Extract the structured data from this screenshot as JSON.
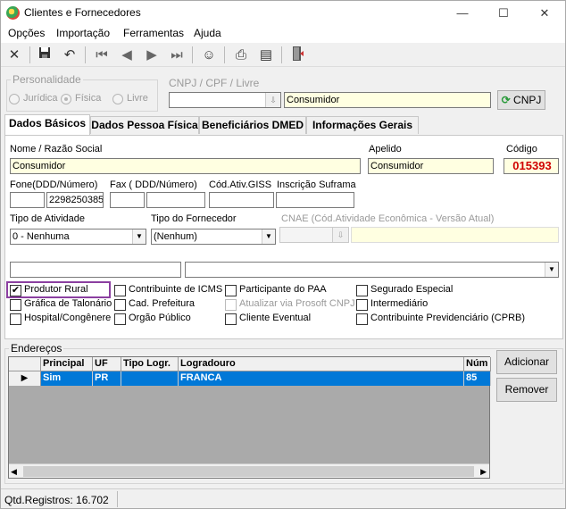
{
  "window": {
    "title": "Clientes e Fornecedores",
    "minimize": "—",
    "maximize": "☐",
    "close": "✕"
  },
  "menu": [
    "Opções",
    "Importação",
    "Ferramentas",
    "Ajuda"
  ],
  "toolbar_icons": [
    "close-icon",
    "save-icon",
    "undo-icon",
    "first-record-icon",
    "previous-record-icon",
    "next-record-icon",
    "last-record-icon",
    "people-icon",
    "print-icon",
    "report-icon",
    "exit-door-icon"
  ],
  "personalidade": {
    "legend": "Personalidade",
    "options": [
      "Jurídica",
      "Física",
      "Livre"
    ],
    "selected": "Física"
  },
  "cnpj": {
    "label": "CNPJ / CPF / Livre",
    "value": "",
    "description": "Consumidor",
    "button": "CNPJ"
  },
  "tabs": [
    "Dados Básicos",
    "Dados Pessoa Física",
    "Beneficiários DMED",
    "Informações Gerais"
  ],
  "form": {
    "nome_label": "Nome / Razão Social",
    "nome_value": "Consumidor",
    "apelido_label": "Apelido",
    "apelido_value": "Consumidor",
    "codigo_label": "Código",
    "codigo_value": "015393",
    "fone_label": "Fone(DDD/Número)",
    "fone_ddd": "",
    "fone_numero": "2298250385",
    "fax_label": "Fax ( DDD/Número)",
    "fax_ddd": "",
    "fax_numero": "",
    "cod_ativ_label": "Cód.Ativ.GISS",
    "cod_ativ_value": "",
    "suframa_label": "Inscrição Suframa",
    "suframa_value": "",
    "tipo_atividade_label": "Tipo de Atividade",
    "tipo_atividade_value": "0 - Nenhuma",
    "tipo_fornecedor_label": "Tipo do Fornecedor",
    "tipo_fornecedor_value": "(Nenhum)",
    "cnae_label": "CNAE (Cód.Atividade Econômica - Versão Atual)",
    "cnae_value": "",
    "extra_field_value": "",
    "extra_combo_value": ""
  },
  "checkboxes": [
    {
      "label": "Produtor Rural",
      "checked": true,
      "enabled": true
    },
    {
      "label": "Gráfica de Talonário",
      "checked": false,
      "enabled": true
    },
    {
      "label": "Hospital/Congênere",
      "checked": false,
      "enabled": true
    },
    {
      "label": "Contribuinte de ICMS",
      "checked": false,
      "enabled": true
    },
    {
      "label": "Cad. Prefeitura",
      "checked": false,
      "enabled": true
    },
    {
      "label": "Orgão Público",
      "checked": false,
      "enabled": true
    },
    {
      "label": "Participante do PAA",
      "checked": false,
      "enabled": true
    },
    {
      "label": "Atualizar via Prosoft CNPJ",
      "checked": false,
      "enabled": false
    },
    {
      "label": "Cliente Eventual",
      "checked": false,
      "enabled": true
    },
    {
      "label": "Segurado Especial",
      "checked": false,
      "enabled": true
    },
    {
      "label": "Intermediário",
      "checked": false,
      "enabled": true
    },
    {
      "label": "Contribuinte Previdenciário (CPRB)",
      "checked": false,
      "enabled": true
    }
  ],
  "enderecos": {
    "legend": "Endereços",
    "columns": [
      "Principal",
      "UF",
      "Tipo Logr.",
      "Logradouro",
      "Núm"
    ],
    "rows": [
      {
        "principal": "Sim",
        "uf": "PR",
        "tipo": "",
        "logradouro": "FRANCA",
        "numero": "85"
      }
    ],
    "add_button": "Adicionar",
    "remove_button": "Remover"
  },
  "status": {
    "registros": "Qtd.Registros: 16.702"
  },
  "colors": {
    "highlight_border": "#8b3fa0",
    "selection": "#0078d7",
    "code_red": "#d00000",
    "yellow_field": "#ffffe1"
  }
}
